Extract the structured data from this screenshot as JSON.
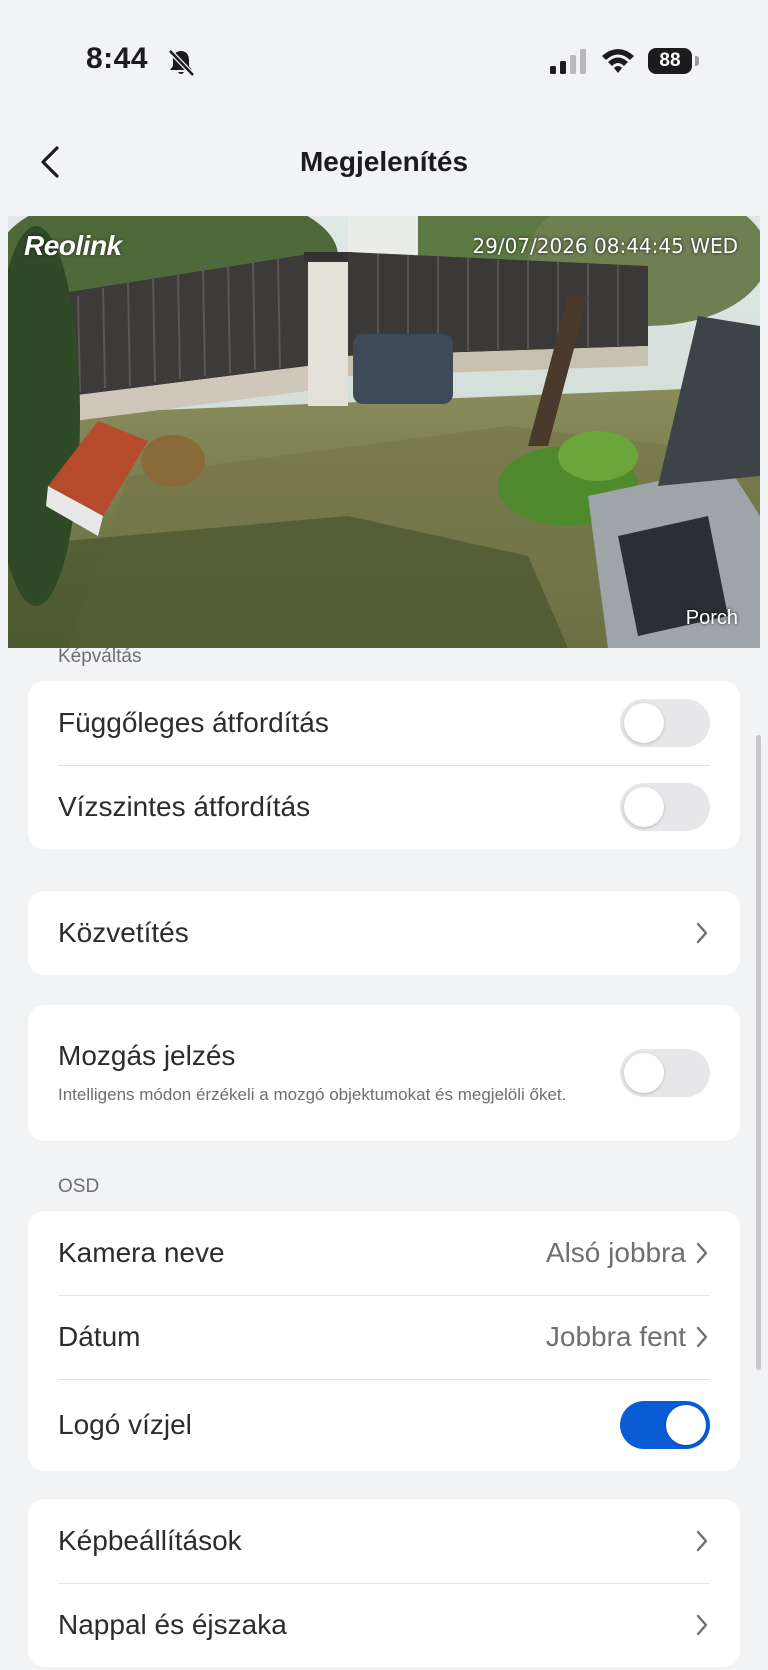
{
  "status_bar": {
    "time": "8:44",
    "battery": "88",
    "icons": [
      "bell-slash-icon",
      "cellular-signal-icon",
      "wifi-icon",
      "battery-icon"
    ]
  },
  "nav": {
    "title": "Megjelenítés",
    "back_icon": "chevron-left-icon"
  },
  "camera": {
    "logo": "Reolink",
    "timestamp": "29/07/2026 08:44:45 WED",
    "name": "Porch"
  },
  "sections": {
    "image_flip": {
      "label": "Képváltás",
      "items": [
        {
          "label": "Függőleges átfordítás",
          "toggle": false
        },
        {
          "label": "Vízszintes átfordítás",
          "toggle": false
        }
      ]
    },
    "stream": {
      "label": "Közvetítés"
    },
    "motion": {
      "label": "Mozgás jelzés",
      "description": "Intelligens módon érzékeli a mozgó objektumokat és megjelöli őket.",
      "toggle": false
    },
    "osd": {
      "label": "OSD",
      "items": [
        {
          "label": "Kamera neve",
          "value": "Alsó jobbra"
        },
        {
          "label": "Dátum",
          "value": "Jobbra fent"
        },
        {
          "label": "Logó vízjel",
          "toggle": true
        }
      ]
    },
    "more": {
      "items": [
        {
          "label": "Képbeállítások"
        },
        {
          "label": "Nappal és éjszaka"
        }
      ]
    }
  },
  "colors": {
    "accent": "#0a5bd6",
    "background": "#f2f3f5",
    "card": "#ffffff",
    "toggle_off": "#e7e7ea"
  }
}
